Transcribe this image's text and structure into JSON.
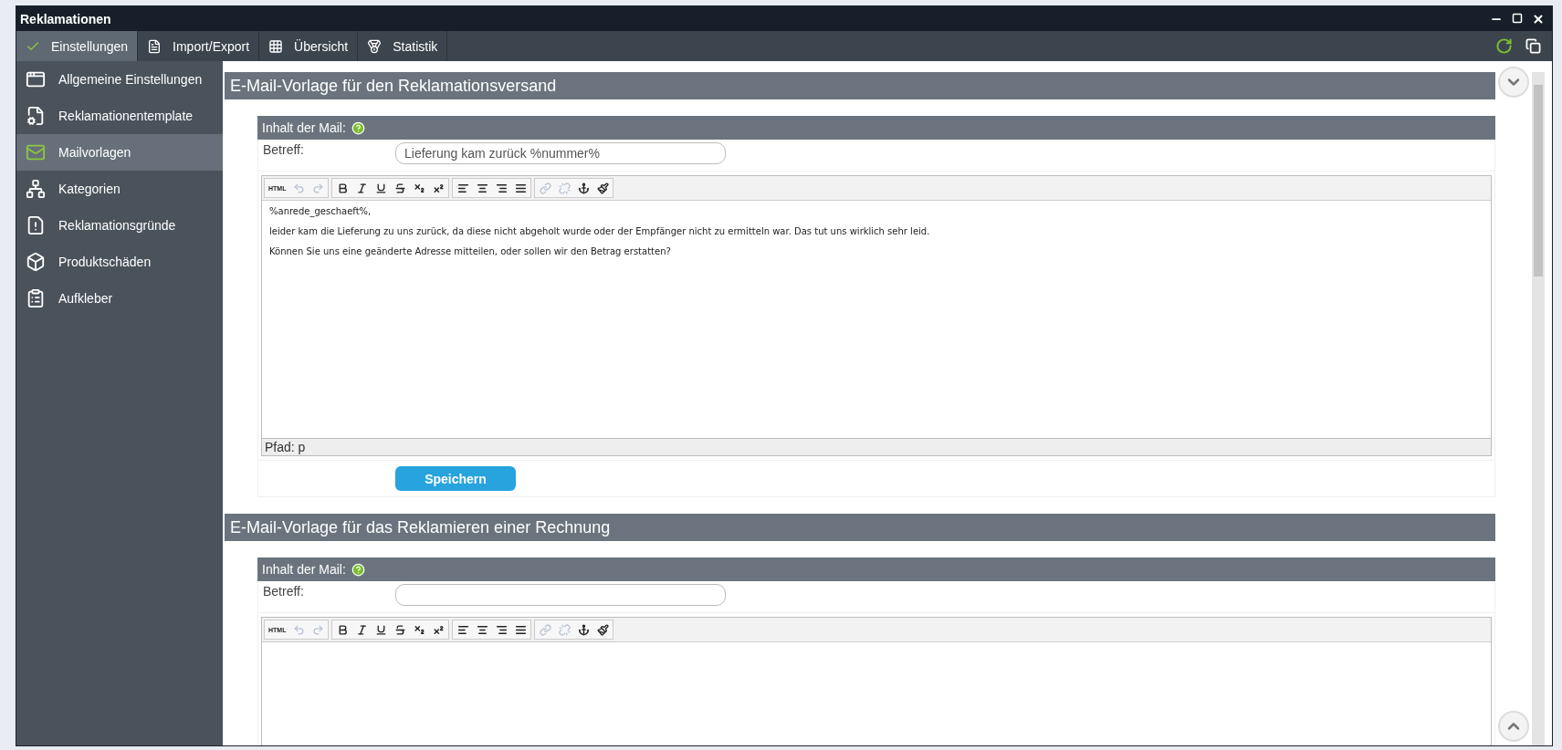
{
  "window": {
    "title": "Reklamationen"
  },
  "menu": [
    {
      "label": "Einstellungen",
      "selected": true
    },
    {
      "label": "Import/Export",
      "selected": false
    },
    {
      "label": "Übersicht",
      "selected": false
    },
    {
      "label": "Statistik",
      "selected": false
    }
  ],
  "sidebar": {
    "items": [
      {
        "label": "Allgemeine Einstellungen",
        "selected": false
      },
      {
        "label": "Reklamationentemplate",
        "selected": false
      },
      {
        "label": "Mailvorlagen",
        "selected": true
      },
      {
        "label": "Kategorien",
        "selected": false
      },
      {
        "label": "Reklamationsgründe",
        "selected": false
      },
      {
        "label": "Produktschäden",
        "selected": false
      },
      {
        "label": "Aufkleber",
        "selected": false
      }
    ]
  },
  "sections": [
    {
      "title": "E-Mail-Vorlage für den Reklamationsversand",
      "content_header": "Inhalt der Mail:",
      "subject_label": "Betreff:",
      "subject_value": "Lieferung kam zurück %nummer%",
      "toolbar": [
        [
          {
            "kind": "html",
            "label": "HTML",
            "disabled": false
          },
          {
            "kind": "undo",
            "disabled": true
          },
          {
            "kind": "redo",
            "disabled": true
          }
        ],
        [
          {
            "kind": "bold",
            "disabled": false
          },
          {
            "kind": "italic",
            "disabled": false
          },
          {
            "kind": "underline",
            "disabled": false
          },
          {
            "kind": "strike",
            "disabled": false
          },
          {
            "kind": "sub",
            "disabled": false
          },
          {
            "kind": "sup",
            "disabled": false
          }
        ],
        [
          {
            "kind": "left",
            "disabled": false
          },
          {
            "kind": "center",
            "disabled": false
          },
          {
            "kind": "right",
            "disabled": false
          },
          {
            "kind": "justify",
            "disabled": false
          }
        ],
        [
          {
            "kind": "link",
            "disabled": true
          },
          {
            "kind": "unlink",
            "disabled": true
          },
          {
            "kind": "anchor",
            "disabled": false
          },
          {
            "kind": "clean",
            "disabled": false
          }
        ]
      ],
      "body": [
        "%anrede_geschaeft%,",
        "leider kam die Lieferung zu uns zurück, da diese nicht abgeholt wurde oder der Empfänger nicht zu ermitteln war. Das tut uns wirklich sehr leid.",
        "Können Sie uns eine geänderte Adresse mitteilen, oder sollen wir den Betrag erstatten?"
      ],
      "path": "Pfad: p",
      "save": "Speichern"
    },
    {
      "title": "E-Mail-Vorlage für das Reklamieren einer Rechnung",
      "content_header": "Inhalt der Mail:",
      "subject_label": "Betreff:",
      "toolbar": [
        [
          {
            "kind": "html",
            "label": "HTML",
            "disabled": false
          },
          {
            "kind": "undo",
            "disabled": true
          },
          {
            "kind": "redo",
            "disabled": true
          }
        ],
        [
          {
            "kind": "bold",
            "disabled": false
          },
          {
            "kind": "italic",
            "disabled": false
          },
          {
            "kind": "underline",
            "disabled": false
          },
          {
            "kind": "strike",
            "disabled": false
          },
          {
            "kind": "sub",
            "disabled": false
          },
          {
            "kind": "sup",
            "disabled": false
          }
        ],
        [
          {
            "kind": "left",
            "disabled": false
          },
          {
            "kind": "center",
            "disabled": false
          },
          {
            "kind": "right",
            "disabled": false
          },
          {
            "kind": "justify",
            "disabled": false
          }
        ],
        [
          {
            "kind": "link",
            "disabled": true
          },
          {
            "kind": "unlink",
            "disabled": true
          },
          {
            "kind": "anchor",
            "disabled": false
          },
          {
            "kind": "clean",
            "disabled": false
          }
        ]
      ]
    }
  ]
}
